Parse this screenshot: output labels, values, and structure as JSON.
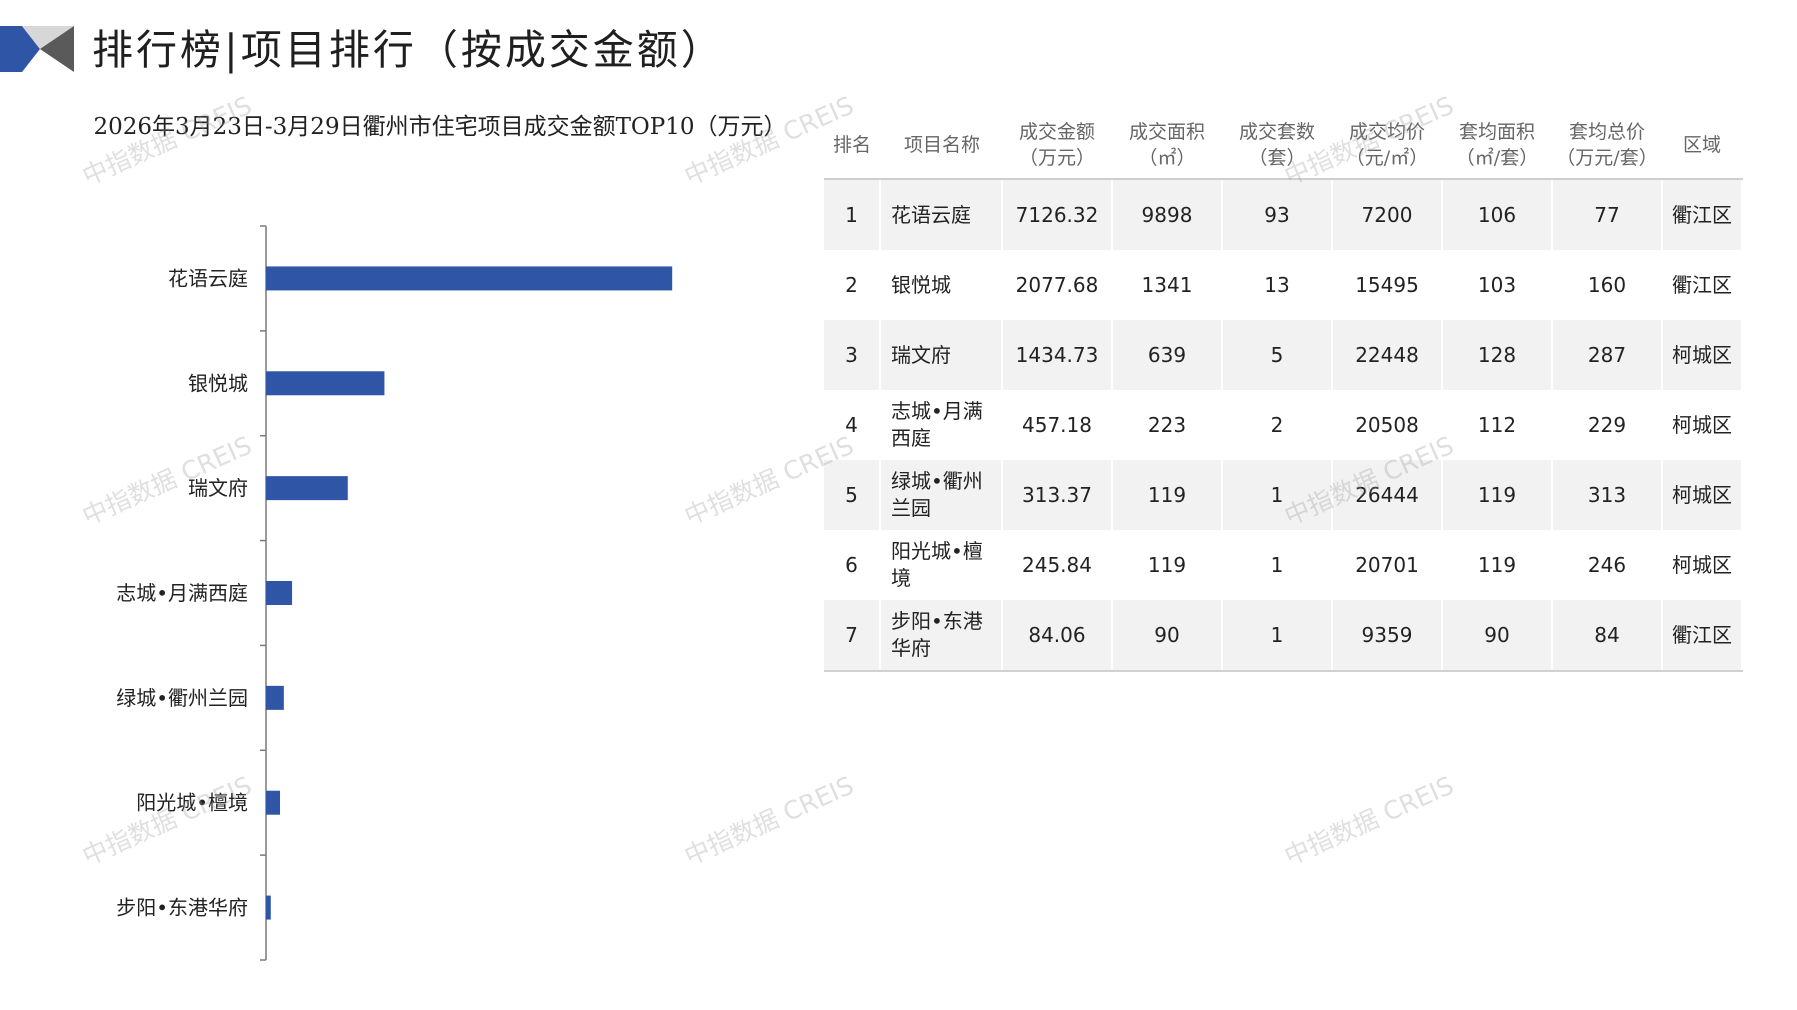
{
  "header": {
    "title": "排行榜|项目排行（按成交金额）"
  },
  "chart_data": {
    "type": "bar",
    "orientation": "horizontal",
    "title": "2026年3月23日-3月29日衢州市住宅项目成交金额TOP10（万元）",
    "categories": [
      "花语云庭",
      "银悦城",
      "瑞文府",
      "志城•月满西庭",
      "绿城•衢州兰园",
      "阳光城•檀境",
      "步阳•东港华府"
    ],
    "values": [
      7126.32,
      2077.68,
      1434.73,
      457.18,
      313.37,
      245.84,
      84.06
    ],
    "bar_color": "#2f56a6",
    "xlim": [
      0,
      8000
    ],
    "grid": false,
    "legend": "none"
  },
  "table": {
    "headers": [
      {
        "line1": "排名",
        "line2": ""
      },
      {
        "line1": "项目名称",
        "line2": ""
      },
      {
        "line1": "成交金额",
        "line2": "（万元）"
      },
      {
        "line1": "成交面积",
        "line2": "（㎡）"
      },
      {
        "line1": "成交套数",
        "line2": "（套）"
      },
      {
        "line1": "成交均价",
        "line2": "（元/㎡）"
      },
      {
        "line1": "套均面积",
        "line2": "（㎡/套）"
      },
      {
        "line1": "套均总价",
        "line2": "（万元/套）"
      },
      {
        "line1": "区域",
        "line2": ""
      }
    ],
    "rows": [
      {
        "rank": "1",
        "name": "花语云庭",
        "amount": "7126.32",
        "area": "9898",
        "units": "93",
        "avg_price": "7200",
        "avg_area": "106",
        "avg_total": "77",
        "region": "衢江区"
      },
      {
        "rank": "2",
        "name": "银悦城",
        "amount": "2077.68",
        "area": "1341",
        "units": "13",
        "avg_price": "15495",
        "avg_area": "103",
        "avg_total": "160",
        "region": "衢江区"
      },
      {
        "rank": "3",
        "name": "瑞文府",
        "amount": "1434.73",
        "area": "639",
        "units": "5",
        "avg_price": "22448",
        "avg_area": "128",
        "avg_total": "287",
        "region": "柯城区"
      },
      {
        "rank": "4",
        "name": "志城•月满西庭",
        "amount": "457.18",
        "area": "223",
        "units": "2",
        "avg_price": "20508",
        "avg_area": "112",
        "avg_total": "229",
        "region": "柯城区"
      },
      {
        "rank": "5",
        "name": "绿城•衢州兰园",
        "amount": "313.37",
        "area": "119",
        "units": "1",
        "avg_price": "26444",
        "avg_area": "119",
        "avg_total": "313",
        "region": "柯城区"
      },
      {
        "rank": "6",
        "name": "阳光城•檀境",
        "amount": "245.84",
        "area": "119",
        "units": "1",
        "avg_price": "20701",
        "avg_area": "119",
        "avg_total": "246",
        "region": "柯城区"
      },
      {
        "rank": "7",
        "name": "步阳•东港华府",
        "amount": "84.06",
        "area": "90",
        "units": "1",
        "avg_price": "9359",
        "avg_area": "90",
        "avg_total": "84",
        "region": "衢江区"
      }
    ]
  },
  "watermark": {
    "text": "中指数据 CREIS"
  }
}
